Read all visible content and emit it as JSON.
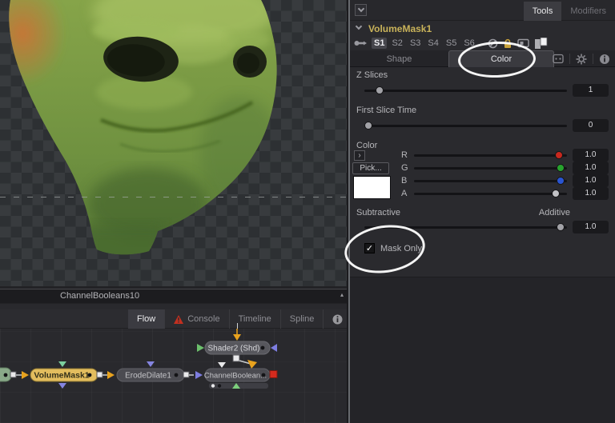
{
  "viewer": {
    "node_label": "ChannelBooleans10",
    "collapse_glyph": "▴"
  },
  "flow": {
    "tabs": [
      {
        "label": "Flow"
      },
      {
        "label": "Console"
      },
      {
        "label": "Timeline"
      },
      {
        "label": "Spline"
      }
    ],
    "nodes": {
      "volume_mask": "VolumeMask1",
      "erode_dilate": "ErodeDilate1",
      "channel_boolean": "ChannelBoolean...",
      "shader": "Shader2 (Shd)"
    }
  },
  "inspector": {
    "top_tabs": {
      "tools": "Tools",
      "modifiers": "Modifiers"
    },
    "node_name": "VolumeMask1",
    "slots": [
      "S1",
      "S2",
      "S3",
      "S4",
      "S5",
      "S6"
    ],
    "subtabs": {
      "shape": "Shape",
      "color": "Color"
    },
    "z_slices": {
      "label": "Z Slices",
      "value": "1"
    },
    "first_slice_time": {
      "label": "First Slice Time",
      "value": "0"
    },
    "color": {
      "label": "Color",
      "expand_glyph": "›",
      "pick_label": "Pick...",
      "channels": [
        {
          "label": "R",
          "value": "1.0",
          "color": "#c8281e",
          "handle_css": "background:#c8281e"
        },
        {
          "label": "G",
          "value": "1.0",
          "color": "#28a32e",
          "handle_css": "background:#28a32e"
        },
        {
          "label": "B",
          "value": "1.0",
          "color": "#2a55d2",
          "handle_css": "background:#2a55d2"
        },
        {
          "label": "A",
          "value": "1.0",
          "color": "#c2c2c6",
          "handle_css": "background:#c2c2c6"
        }
      ]
    },
    "blend": {
      "left_label": "Subtractive",
      "right_label": "Additive",
      "value": "1.0"
    },
    "mask_only": {
      "label": "Mask Only",
      "check_glyph": "✓"
    }
  },
  "colors": {
    "accent_gold": "#c9b35a",
    "node_yellow": "#e3bd5e",
    "warning_red": "#c23020",
    "connection_orange": "#e8a21e",
    "connection_purple": "#7d7de0"
  }
}
